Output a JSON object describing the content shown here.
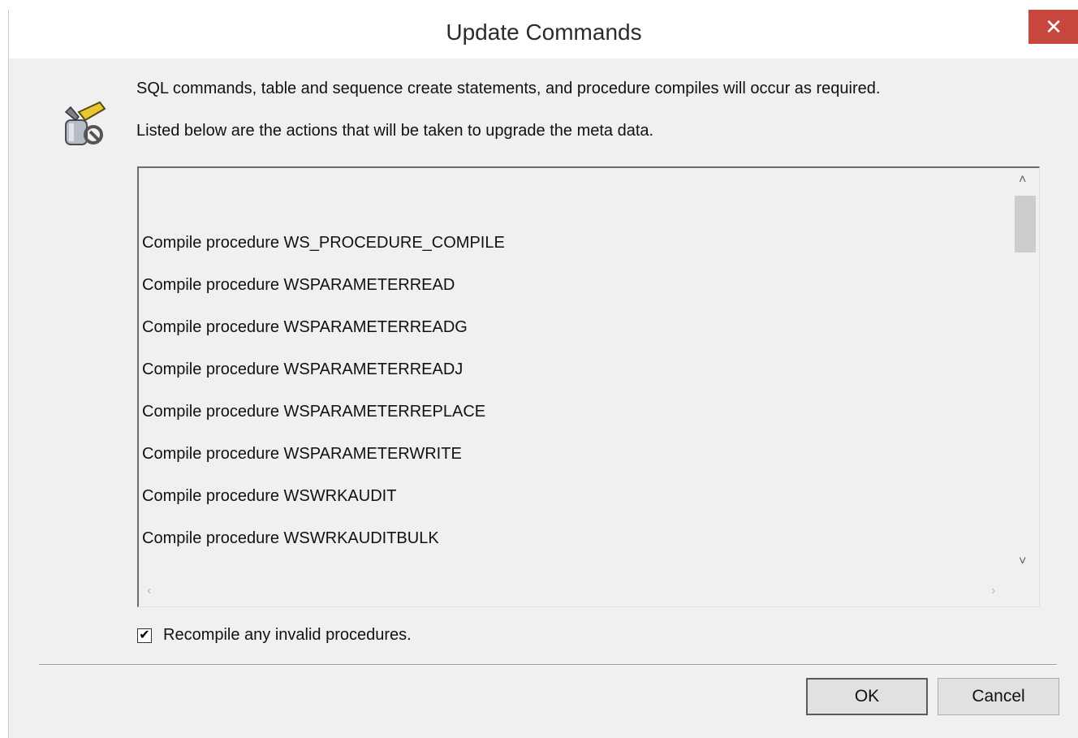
{
  "window": {
    "title": "Update Commands",
    "close_glyph": "✕"
  },
  "icon": {
    "name": "tools-wrench-hammer-icon"
  },
  "messages": {
    "line1": "SQL commands, table and sequence create statements, and procedure compiles will occur as required.",
    "line2": "Listed below are the actions that will be taken to upgrade the meta data."
  },
  "actions": [
    "Compile procedure WS_PROCEDURE_COMPILE",
    "Compile procedure WSPARAMETERREAD",
    "Compile procedure WSPARAMETERREADG",
    "Compile procedure WSPARAMETERREADJ",
    "Compile procedure WSPARAMETERREPLACE",
    "Compile procedure WSPARAMETERWRITE",
    "Compile procedure WSWRKAUDIT",
    "Compile procedure WSWRKAUDITBULK"
  ],
  "recompile": {
    "label": "Recompile any invalid procedures.",
    "checked": true,
    "check_glyph": "✔"
  },
  "buttons": {
    "ok": "OK",
    "cancel": "Cancel"
  },
  "colors": {
    "close_red": "#c7463e",
    "dialog_bg": "#f0f0f0"
  }
}
